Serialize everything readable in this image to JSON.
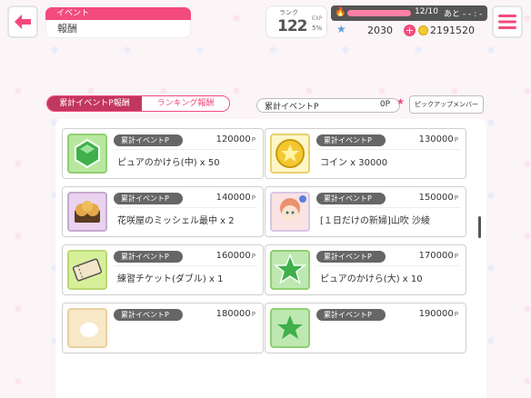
{
  "header": {
    "category": "イベント",
    "title": "報酬",
    "rank_label": "ランク",
    "rank": "122",
    "exp_label": "EXP",
    "exp_pct": "5%",
    "lp": "12/10",
    "lp_after": "あと",
    "lp_time": "- - : - -",
    "stars": "2030",
    "coins": "2191520"
  },
  "tabs": [
    {
      "label": "累計イベントP報酬",
      "active": true
    },
    {
      "label": "ランキング報酬",
      "active": false
    }
  ],
  "points": {
    "label": "累計イベントP",
    "value": "0P"
  },
  "pickup_button": "ピックアップメンバー",
  "rewards": [
    {
      "pill": "累計イベントP",
      "points": "120000",
      "unit": "P",
      "reward": "ピュアのかけら(中) x 50",
      "icon": "green-gem-icon"
    },
    {
      "pill": "累計イベントP",
      "points": "130000",
      "unit": "P",
      "reward": "コイン x 30000",
      "icon": "coin-icon"
    },
    {
      "pill": "累計イベントP",
      "points": "140000",
      "unit": "P",
      "reward": "花咲屋のミッシェル最中 x 2",
      "icon": "monaka-icon"
    },
    {
      "pill": "累計イベントP",
      "points": "150000",
      "unit": "P",
      "reward": "[１日だけの新婦]山吹 沙綾",
      "icon": "member-card-icon"
    },
    {
      "pill": "累計イベントP",
      "points": "160000",
      "unit": "P",
      "reward": "練習チケット(ダブル) x 1",
      "icon": "ticket-icon"
    },
    {
      "pill": "累計イベントP",
      "points": "170000",
      "unit": "P",
      "reward": "ピュアのかけら(大) x 10",
      "icon": "green-star-icon"
    },
    {
      "pill": "累計イベントP",
      "points": "180000",
      "unit": "P",
      "reward": "",
      "icon": "item-icon"
    },
    {
      "pill": "累計イベントP",
      "points": "190000",
      "unit": "P",
      "reward": "",
      "icon": "green-star-icon"
    }
  ]
}
